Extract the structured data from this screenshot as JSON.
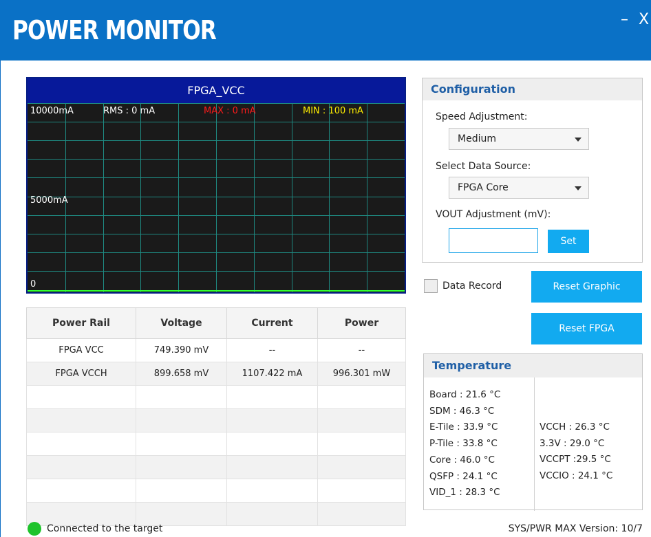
{
  "window": {
    "title": "POWER MONITOR",
    "minimize_glyph": "–",
    "close_glyph": "X"
  },
  "graph": {
    "title": "FPGA_VCC",
    "y_top_label": "10000mA",
    "y_mid_label": "5000mA",
    "y_bottom_label": "0",
    "rms": "RMS : 0 mA",
    "max": "MAX : 0 mA",
    "min": "MIN : 100 mA",
    "colors": {
      "bg": "#1a1a1a",
      "header": "#07199a",
      "grid": "#1e8a82",
      "baseline": "#33ff33",
      "max": "#ff1a1a",
      "min": "#ffee00"
    }
  },
  "table": {
    "headers": [
      "Power Rail",
      "Voltage",
      "Current",
      "Power"
    ],
    "rows": [
      [
        "FPGA VCC",
        "749.390 mV",
        "--",
        "--"
      ],
      [
        "FPGA VCCH",
        "899.658 mV",
        "1107.422 mA",
        "996.301 mW"
      ]
    ]
  },
  "config": {
    "title": "Configuration",
    "speed_label": "Speed Adjustment:",
    "speed_value": "Medium",
    "source_label": "Select Data Source:",
    "source_value": "FPGA Core",
    "vout_label": "VOUT Adjustment (mV):",
    "vout_value": "",
    "set_label": "Set"
  },
  "controls": {
    "data_record_label": "Data Record",
    "reset_graphic_label": "Reset Graphic",
    "reset_fpga_label": "Reset FPGA"
  },
  "temperature": {
    "title": "Temperature",
    "left": [
      "Board :  21.6 °C",
      "SDM :    46.3 °C",
      "E-Tile : 33.9 °C",
      "P-Tile : 33.8 °C",
      "Core :   46.0 °C",
      "QSFP :  24.1 °C",
      "VID_1 :  28.3 °C"
    ],
    "right": [
      "VCCH :  26.3 °C",
      "3.3V :    29.0 °C",
      "VCCPT :29.5 °C",
      "VCCIO : 24.1 °C"
    ]
  },
  "status": {
    "connection": "Connected to the target",
    "version": "SYS/PWR MAX Version:  10/7"
  }
}
